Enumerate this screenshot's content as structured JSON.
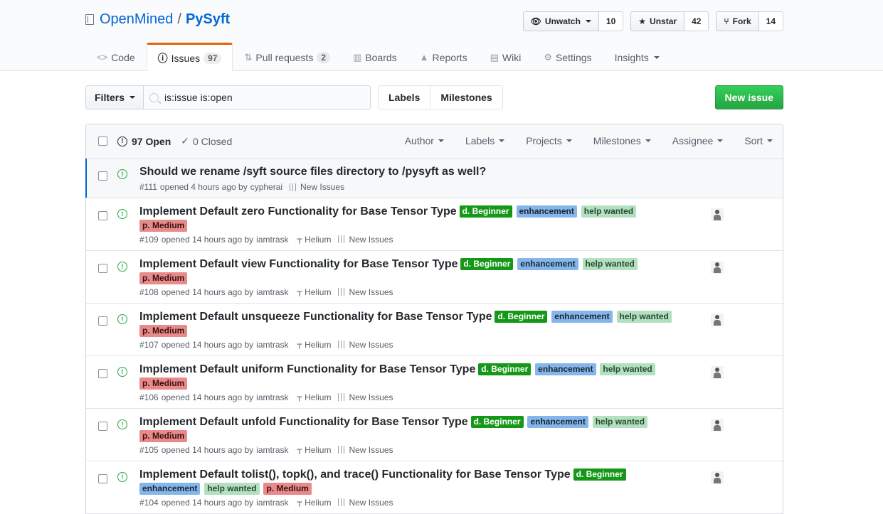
{
  "repo": {
    "owner": "OpenMined",
    "separator": "/",
    "name": "PySyft"
  },
  "actions": {
    "watch": {
      "label": "Unwatch",
      "count": "10"
    },
    "star": {
      "label": "Unstar",
      "count": "42"
    },
    "fork": {
      "label": "Fork",
      "count": "14"
    }
  },
  "nav": {
    "code": "Code",
    "issues": "Issues",
    "issues_count": "97",
    "pulls": "Pull requests",
    "pulls_count": "2",
    "boards": "Boards",
    "reports": "Reports",
    "wiki": "Wiki",
    "settings": "Settings",
    "insights": "Insights"
  },
  "subnav": {
    "filters": "Filters",
    "search_value": "is:issue is:open",
    "labels": "Labels",
    "milestones": "Milestones",
    "new_issue": "New issue"
  },
  "list_header": {
    "open": "97 Open",
    "closed": "0 Closed",
    "filters": [
      "Author",
      "Labels",
      "Projects",
      "Milestones",
      "Assignee",
      "Sort"
    ]
  },
  "issues": [
    {
      "title": "Should we rename /syft source files directory to /pysyft as well?",
      "labels": [],
      "number": "#111",
      "opened": "opened 4 hours ago by",
      "author": "cypherai",
      "milestone": "",
      "project": "New Issues",
      "avatar": false
    },
    {
      "title": "Implement Default zero Functionality for Base Tensor Type",
      "labels": [
        "d. Beginner",
        "enhancement",
        "help wanted",
        "p. Medium"
      ],
      "number": "#109",
      "opened": "opened 14 hours ago by",
      "author": "iamtrask",
      "milestone": "Helium",
      "project": "New Issues",
      "avatar": true
    },
    {
      "title": "Implement Default view Functionality for Base Tensor Type",
      "labels": [
        "d. Beginner",
        "enhancement",
        "help wanted",
        "p. Medium"
      ],
      "number": "#108",
      "opened": "opened 14 hours ago by",
      "author": "iamtrask",
      "milestone": "Helium",
      "project": "New Issues",
      "avatar": true
    },
    {
      "title": "Implement Default unsqueeze Functionality for Base Tensor Type",
      "labels": [
        "d. Beginner",
        "enhancement",
        "help wanted",
        "p. Medium"
      ],
      "number": "#107",
      "opened": "opened 14 hours ago by",
      "author": "iamtrask",
      "milestone": "Helium",
      "project": "New Issues",
      "avatar": true
    },
    {
      "title": "Implement Default uniform Functionality for Base Tensor Type",
      "labels": [
        "d. Beginner",
        "enhancement",
        "help wanted",
        "p. Medium"
      ],
      "number": "#106",
      "opened": "opened 14 hours ago by",
      "author": "iamtrask",
      "milestone": "Helium",
      "project": "New Issues",
      "avatar": true
    },
    {
      "title": "Implement Default unfold Functionality for Base Tensor Type",
      "labels": [
        "d. Beginner",
        "enhancement",
        "help wanted",
        "p. Medium"
      ],
      "number": "#105",
      "opened": "opened 14 hours ago by",
      "author": "iamtrask",
      "milestone": "Helium",
      "project": "New Issues",
      "avatar": true
    },
    {
      "title": "Implement Default tolist(), topk(), and trace() Functionality for Base Tensor Type",
      "labels": [
        "d. Beginner",
        "enhancement",
        "help wanted",
        "p. Medium"
      ],
      "number": "#104",
      "opened": "opened 14 hours ago by",
      "author": "iamtrask",
      "milestone": "Helium",
      "project": "New Issues",
      "avatar": true
    }
  ],
  "label_colors": {
    "d. Beginner": "#159818",
    "enhancement": "#84b6eb",
    "help wanted": "#b3e0bf",
    "p. Medium": "#e88a8a"
  }
}
